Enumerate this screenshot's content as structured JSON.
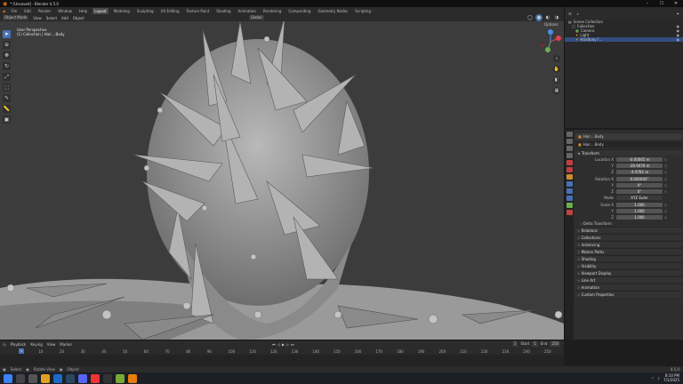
{
  "window": {
    "title": "* [Unsaved] - Blender 4.5.0",
    "controls": [
      "–",
      "☐",
      "✕"
    ]
  },
  "menu": [
    "File",
    "Edit",
    "Render",
    "Window",
    "Help"
  ],
  "workspaces": [
    "Layout",
    "Modeling",
    "Sculpting",
    "UV Editing",
    "Texture Paint",
    "Shading",
    "Animation",
    "Rendering",
    "Compositing",
    "Geometry Nodes",
    "Scripting"
  ],
  "active_workspace": "Layout",
  "scene": {
    "label": "Scene",
    "view_layer": "ViewLayer"
  },
  "viewport_header": {
    "mode": "Object Mode",
    "items": [
      "View",
      "Select",
      "Add",
      "Object"
    ],
    "orientation": "Global",
    "options": "Options"
  },
  "viewport_overlay": {
    "line1": "User Perspective",
    "line2": "(1) Collection | Hair....Body"
  },
  "outliner": {
    "title": "Scene Collection",
    "rows": [
      {
        "label": "Collection",
        "icon_color": "#e0e0e0"
      },
      {
        "label": "Camera",
        "icon_color": "#6aa84f"
      },
      {
        "label": "Light",
        "icon_color": "#e0a040"
      },
      {
        "label": "HairBody.?...",
        "icon_color": "#e0a040"
      }
    ]
  },
  "properties": {
    "object_name": "Hair....Body",
    "object_field": "Hair....Body",
    "transform_title": "Transform",
    "location": {
      "label": "Location X",
      "x": "-0.00065 m",
      "y": "-39.9476 m",
      "z": "-4.9781 m"
    },
    "rotation": {
      "label": "Rotation X",
      "x": "0.000004°",
      "y": "0°",
      "z": "0°"
    },
    "mode": {
      "label": "Mode",
      "value": "XYZ Euler"
    },
    "scale": {
      "label": "Scale X",
      "x": "1.000",
      "y": "1.000",
      "z": "1.000"
    },
    "axis": {
      "y": "Y",
      "z": "Z"
    },
    "delta": "Delta Transform",
    "sections": [
      "Relations",
      "Collections",
      "Instancing",
      "Motion Paths",
      "Shading",
      "Visibility",
      "Viewport Display",
      "Line Art",
      "Animation",
      "Custom Properties"
    ]
  },
  "timeline": {
    "menu": [
      "Playback",
      "Keying",
      "View",
      "Marker"
    ],
    "current_frame": "1",
    "start_label": "Start",
    "start": "1",
    "end_label": "End",
    "end": "250",
    "frames": [
      "1",
      "10",
      "20",
      "30",
      "40",
      "50",
      "60",
      "70",
      "80",
      "90",
      "100",
      "110",
      "120",
      "130",
      "140",
      "150",
      "160",
      "170",
      "180",
      "190",
      "200",
      "210",
      "220",
      "230",
      "240",
      "250"
    ]
  },
  "statusbar": {
    "items": [
      "Select",
      "Rotate View",
      "Object"
    ],
    "version": "4.5.0"
  },
  "taskbar": {
    "time": "8:10 PM",
    "date": "7/1/2025"
  },
  "icons": [
    "blender-logo-icon",
    "search-icon",
    "eye-icon",
    "camera-icon",
    "light-icon",
    "cursor-icon",
    "move-icon",
    "rotate-icon",
    "scale-icon",
    "zoom-icon",
    "hand-icon",
    "play-icon",
    "windows-start-icon"
  ]
}
